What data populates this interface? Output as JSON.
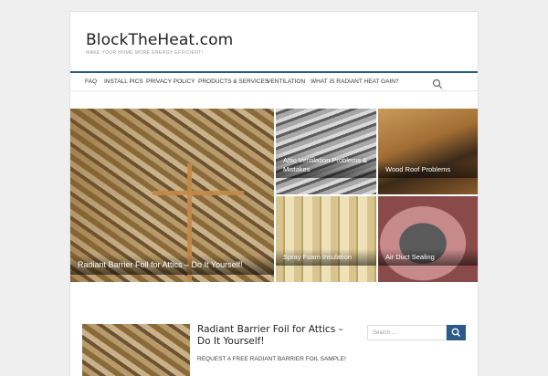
{
  "site": {
    "title": "BlockTheHeat.com",
    "tagline": "Make your home more energy efficient!"
  },
  "nav": {
    "items": [
      {
        "label": "FAQ"
      },
      {
        "label": "Install Pics"
      },
      {
        "label": "Privacy Policy"
      },
      {
        "label": "Products & Services"
      },
      {
        "label": "Ventilation"
      },
      {
        "label": "What is Radiant Heat Gain?"
      }
    ],
    "search_icon": "search-icon"
  },
  "featured": [
    {
      "caption": "Radiant Barrier Foil for Attics – Do It Yourself!"
    },
    {
      "caption": "Attic Ventilation Problems & Mistakes"
    },
    {
      "caption": "Wood Roof Problems"
    },
    {
      "caption": "Spray Foam Insulation"
    },
    {
      "caption": "Air Duct Sealing"
    }
  ],
  "post": {
    "title": "Radiant Barrier Foil for Attics – Do It Yourself!",
    "excerpt": "REQUEST A FREE RADIANT BARRIER FOIL SAMPLE!"
  },
  "sidebar": {
    "search_placeholder": "Search ...",
    "search_button_icon": "search-icon"
  },
  "colors": {
    "accent": "#2a5a8a",
    "background": "#efefef"
  }
}
